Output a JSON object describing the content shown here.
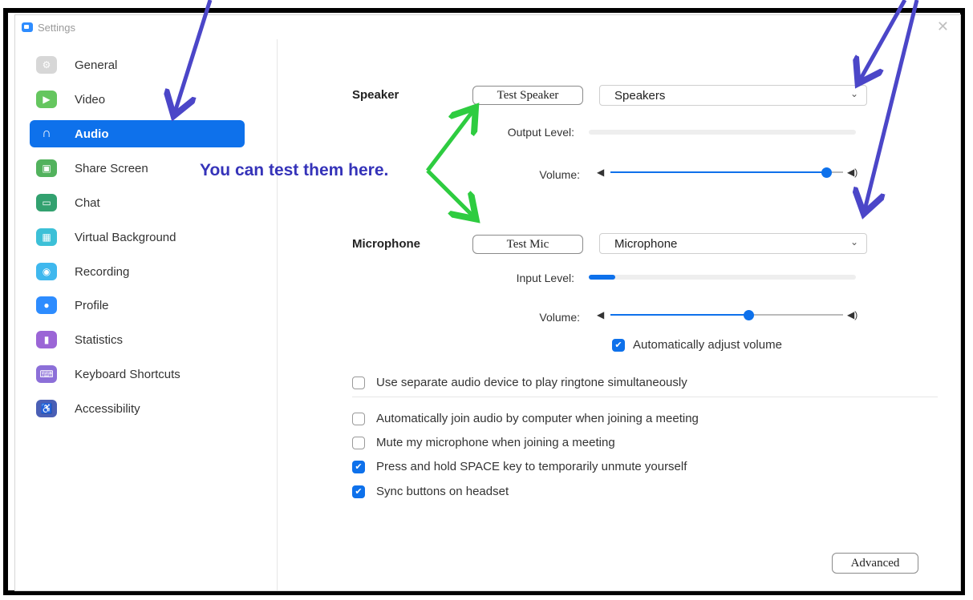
{
  "window": {
    "title": "Settings",
    "close_icon": "close-icon"
  },
  "sidebar": {
    "items": [
      {
        "label": "General",
        "icon": "gear-icon",
        "color": "#d7d7d7"
      },
      {
        "label": "Video",
        "icon": "video-camera-icon",
        "color": "#65c65f"
      },
      {
        "label": "Audio",
        "icon": "headphones-icon",
        "color": "#0e71eb"
      },
      {
        "label": "Share Screen",
        "icon": "share-screen-icon",
        "color": "#52b25d"
      },
      {
        "label": "Chat",
        "icon": "chat-bubble-icon",
        "color": "#32a16f"
      },
      {
        "label": "Virtual Background",
        "icon": "virtual-background-icon",
        "color": "#3cc0d7"
      },
      {
        "label": "Recording",
        "icon": "recording-icon",
        "color": "#3fb8ee"
      },
      {
        "label": "Profile",
        "icon": "profile-icon",
        "color": "#2d8cff"
      },
      {
        "label": "Statistics",
        "icon": "statistics-icon",
        "color": "#9b65d6"
      },
      {
        "label": "Keyboard Shortcuts",
        "icon": "keyboard-icon",
        "color": "#8c6fd8"
      },
      {
        "label": "Accessibility",
        "icon": "accessibility-icon",
        "color": "#4a5fb5"
      }
    ],
    "active": "Audio"
  },
  "speaker": {
    "label": "Speaker",
    "test_button": "Test Speaker",
    "device": "Speakers",
    "output_level_label": "Output Level:",
    "output_level": 0.0,
    "volume_label": "Volume:",
    "volume": 0.95
  },
  "microphone": {
    "label": "Microphone",
    "test_button": "Test Mic",
    "device": "Microphone",
    "input_level_label": "Input Level:",
    "input_level": 0.1,
    "volume_label": "Volume:",
    "volume": 0.6,
    "auto_adjust": {
      "label": "Automatically adjust volume",
      "checked": true
    }
  },
  "options": [
    {
      "label": "Use separate audio device to play ringtone simultaneously",
      "checked": false
    },
    {
      "label": "Automatically join audio by computer when joining a meeting",
      "checked": false
    },
    {
      "label": "Mute my microphone when joining a meeting",
      "checked": false
    },
    {
      "label": "Press and hold SPACE key to temporarily unmute yourself",
      "checked": true
    },
    {
      "label": "Sync buttons on headset",
      "checked": true
    }
  ],
  "advanced_button": "Advanced",
  "annotation": {
    "text": "You can test them here.",
    "color": "#3533b9"
  },
  "colors": {
    "accent": "#0e71eb",
    "annotation_blue": "#4b46c8",
    "annotation_green": "#2ecc40"
  }
}
